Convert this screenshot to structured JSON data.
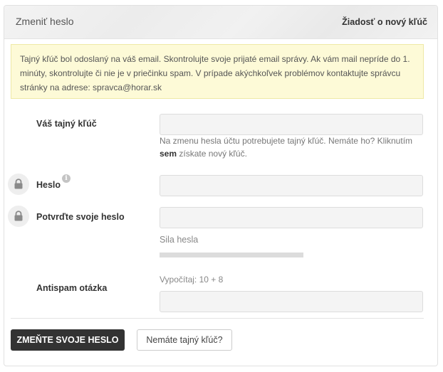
{
  "header": {
    "title": "Zmeniť heslo",
    "link": "Žiadosť o nový kľúč"
  },
  "alert": {
    "text": "Tajný kľúč bol odoslaný na váš email. Skontrolujte svoje prijaté email správy. Ak vám mail nepríde do 1. minúty, skontrolujte či nie je v priečinku spam. V prípade akýchkoľvek problémov kontaktujte správcu stránky na adrese: spravca@horar.sk"
  },
  "form": {
    "secret_key": {
      "label": "Váš tajný kľúč",
      "value": "",
      "help_before": "Na zmenu hesla účtu potrebujete tajný kľúč. Nemáte ho? Kliknutím",
      "help_link": "sem",
      "help_after": "získate nový kľúč."
    },
    "password": {
      "label": "Heslo",
      "value": "",
      "info_icon": "info-icon",
      "icon": "lock-icon"
    },
    "confirm_password": {
      "label": "Potvrďte svoje heslo",
      "value": "",
      "icon": "lock-icon"
    },
    "strength": {
      "label": "Sila hesla",
      "level": 0
    },
    "antispam": {
      "label": "Antispam otázka",
      "question": "Vypočítaj: 10 + 8",
      "value": ""
    }
  },
  "buttons": {
    "submit": "ZMEŇTE SVOJE HESLO",
    "no_key": "Nemáte tajný kľúč?"
  },
  "colors": {
    "primary_button": "#333333",
    "alert_background": "#fdfad7",
    "alert_border": "#eee9a6",
    "input_background": "#f4f4f4"
  }
}
